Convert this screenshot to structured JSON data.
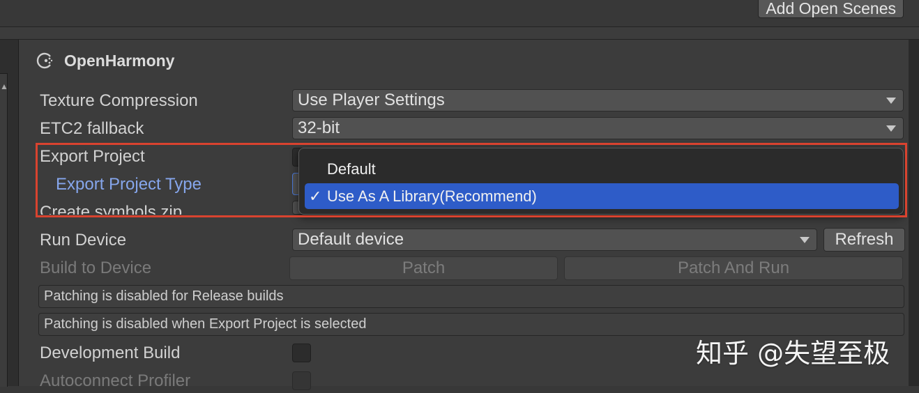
{
  "toolbar": {
    "add_open_scenes": "Add Open Scenes"
  },
  "section": {
    "title": "OpenHarmony",
    "icon": "openharmony-logo-icon"
  },
  "settings": {
    "texture_compression": {
      "label": "Texture Compression",
      "value": "Use Player Settings"
    },
    "etc2_fallback": {
      "label": "ETC2 fallback",
      "value": "32-bit"
    },
    "export_project": {
      "label": "Export Project"
    },
    "export_project_type": {
      "label": "Export Project Type"
    },
    "create_symbols_zip": {
      "label": "Create symbols.zip"
    },
    "run_device": {
      "label": "Run Device",
      "value": "Default device",
      "refresh": "Refresh"
    },
    "build_to_device": {
      "label": "Build to Device",
      "patch": "Patch",
      "patch_and_run": "Patch And Run"
    },
    "info_release": "Patching is disabled for Release builds",
    "info_export": "Patching is disabled when Export Project is selected",
    "development_build": {
      "label": "Development Build",
      "checked": false
    },
    "autoconnect_profiler": {
      "label": "Autoconnect Profiler",
      "checked": false
    }
  },
  "popup": {
    "items": [
      {
        "label": "Default",
        "selected": false
      },
      {
        "label": "Use As A Library(Recommend)",
        "selected": true,
        "check": "✓"
      }
    ]
  },
  "annotation": {
    "highlight_color": "#d9432f"
  },
  "watermark": "知乎 @失望至极"
}
